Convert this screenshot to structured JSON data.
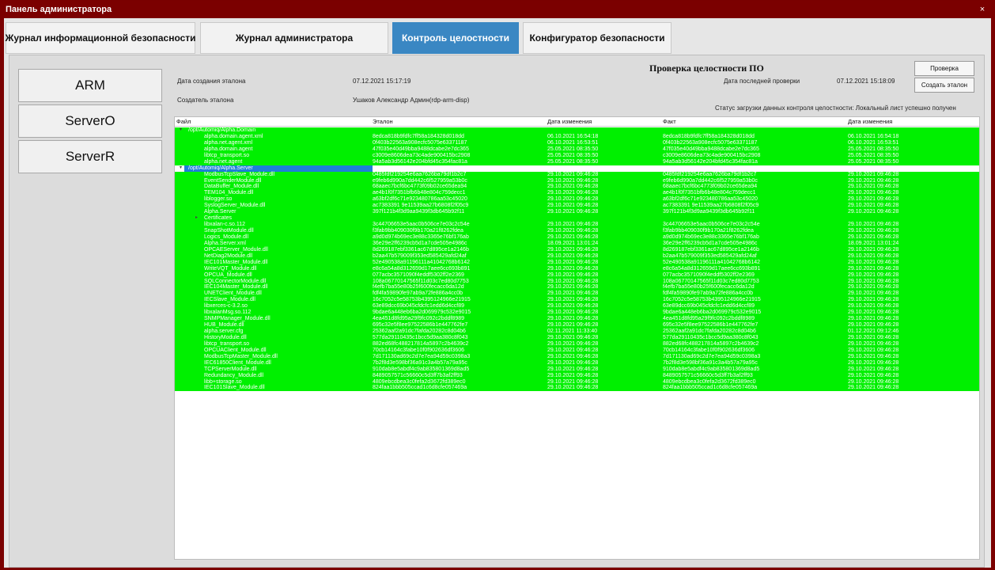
{
  "window": {
    "title": "Панель администратора",
    "close_glyph": "×"
  },
  "tabs": [
    {
      "label": "Журнал информационной безопасности",
      "active": false
    },
    {
      "label": "Журнал администратора",
      "active": false
    },
    {
      "label": "Контроль целостности",
      "active": true
    },
    {
      "label": "Конфигуратор безопасности",
      "active": false
    }
  ],
  "servers": [
    "ARM",
    "ServerO",
    "ServerR"
  ],
  "info": {
    "title": "Проверка целостности ПО",
    "created_label": "Дата создания эталона",
    "created_value": "07.12.2021 15:17:19",
    "creator_label": "Создатель эталона",
    "creator_value": "Ушаков Александр Админ(rdp-arm-disp)",
    "last_check_label": "Дата последней проверки",
    "last_check_value": "07.12.2021 15:18:09",
    "status": "Статус загрузки данных контроля целостности: Локальный лист успешно получен"
  },
  "buttons": {
    "check": "Проверка",
    "create": "Создать эталон"
  },
  "table": {
    "headers": [
      "Файл",
      "Эталон",
      "Дата изменения",
      "Факт",
      "Дата изменения"
    ],
    "rows": [
      {
        "indent": 1,
        "arrow": "▾",
        "file": "/opt/Automiq/Alpha.Domain",
        "ref": "",
        "d1": "",
        "fact": "",
        "d2": "",
        "green": true
      },
      {
        "indent": 2,
        "file": "alpha.domain.agent.xml",
        "ref": "8edca818b9fdfc7ff58a184328d018dd",
        "d1": "06.10.2021 16:54:18",
        "fact": "8edca818b9fdfc7ff58a184328d018dd",
        "d2": "06.10.2021 16:54:18",
        "green": true
      },
      {
        "indent": 2,
        "file": "alpha.net.agent.xml",
        "ref": "0f403b22563a908ecfc5075e63371187",
        "d1": "06.10.2021 16:53:51",
        "fact": "0f403b22563a908ecfc5075e63371187",
        "d2": "06.10.2021 16:53:51",
        "green": true
      },
      {
        "indent": 2,
        "file": "alpha.domain.agent",
        "ref": "47f035e40d49bba9488dcabe2e7dc365",
        "d1": "25.05.2021 08:35:50",
        "fact": "47f035e40d49bba9488dcabe2e7dc365",
        "d2": "25.05.2021 08:35:50",
        "green": true
      },
      {
        "indent": 2,
        "file": "libtcp_transport.so",
        "ref": "c3009e8606dea73c4ade900415bc2908",
        "d1": "25.05.2021 08:35:50",
        "fact": "c3009e8606dea73c4ade900415bc2908",
        "d2": "25.05.2021 08:35:50",
        "green": true
      },
      {
        "indent": 2,
        "file": "alpha.net.agent",
        "ref": "94a5ab3d56142e204bfd45c354fac81a",
        "d1": "25.05.2021 08:35:50",
        "fact": "94a5ab3d56142e204bfd45c354fac81a",
        "d2": "25.05.2021 08:35:50",
        "green": true
      },
      {
        "indent": 1,
        "arrow": "▾",
        "file": "/opt/Automiq/Alpha.Server",
        "ref": "",
        "d1": "",
        "fact": "",
        "d2": "",
        "green": false,
        "selected": true
      },
      {
        "indent": 2,
        "file": "ModbusTcpSlave_Module.dll",
        "ref": "0485fdf219254e6aa7626ba79df1b2c7",
        "d1": "29.10.2021 09:46:28",
        "fact": "0485fdf219254e6aa7626ba79df1b2c7",
        "d2": "29.10.2021 09:46:28",
        "green": true
      },
      {
        "indent": 2,
        "file": "EventSenderModule.dll",
        "ref": "e9feb6d990a7dd442c6f527959a53b0c",
        "d1": "29.10.2021 09:46:28",
        "fact": "e9feb6d990a7dd442c6f527959a53b0c",
        "d2": "29.10.2021 09:46:28",
        "green": true
      },
      {
        "indent": 2,
        "file": "DataBuffer_Module.dll",
        "ref": "68aaec7bcf6bc4773f09b02ce65dea94",
        "d1": "29.10.2021 09:46:28",
        "fact": "68aaec7bcf6bc4773f09b02ce65dea94",
        "d2": "29.10.2021 09:46:28",
        "green": true
      },
      {
        "indent": 2,
        "file": "TEM104_Module.dll",
        "ref": "ae4b1f0f7351bfb6b48e804c759decc1",
        "d1": "29.10.2021 09:46:28",
        "fact": "ae4b1f0f7351bfb6b48e804c759decc1",
        "d2": "29.10.2021 09:46:28",
        "green": true
      },
      {
        "indent": 2,
        "file": "liblogger.so",
        "ref": "a63bf2df6c71e923480786aa53c45020",
        "d1": "29.10.2021 09:46:28",
        "fact": "a63bf2df6c71e923480786aa53c45020",
        "d2": "29.10.2021 09:46:28",
        "green": true
      },
      {
        "indent": 2,
        "file": "SyslogServer_Module.dll",
        "ref": "ac7383391 9e11539aa27b6808f2f05c9",
        "d1": "29.10.2021 09:46:28",
        "fact": "ac7383391 9e11539aa27b6808f2f05c9",
        "d2": "29.10.2021 09:46:28",
        "green": true
      },
      {
        "indent": 2,
        "file": "Alpha.Server",
        "ref": "397f121b4f3d9aa9439f3db645b92f11",
        "d1": "29.10.2021 09:46:28",
        "fact": "397f121b4f3d9aa9439f3db645b92f11",
        "d2": "29.10.2021 09:46:28",
        "green": true
      },
      {
        "indent": 2,
        "arrow": "▸",
        "file": "Certificates",
        "ref": "",
        "d1": "",
        "fact": "",
        "d2": "",
        "green": true
      },
      {
        "indent": 2,
        "file": "libxalan-c.so.112",
        "ref": "3c44706653e5aac0b506ce7e03c2c54e",
        "d1": "29.10.2021 09:46:28",
        "fact": "3c44706653e5aac0b506ce7e03c2c54e",
        "d2": "29.10.2021 09:46:28",
        "green": true
      },
      {
        "indent": 2,
        "file": "SnapShotModule.dll",
        "ref": "f3fab9bb409030f9b170a21f8262fdea",
        "d1": "29.10.2021 09:46:28",
        "fact": "f3fab9bb409030f9b170a21f8262fdea",
        "d2": "29.10.2021 09:46:28",
        "green": true
      },
      {
        "indent": 2,
        "file": "Logics_Module.dll",
        "ref": "a9d0d974b69ec3e88c3365e76bf176ab",
        "d1": "29.10.2021 09:46:28",
        "fact": "a9d0d974b69ec3e88c3365e76bf176ab",
        "d2": "29.10.2021 09:46:28",
        "green": true
      },
      {
        "indent": 2,
        "file": "Alpha.Server.xml",
        "ref": "36e29e2ff6239cb5d1a7cde505e4986c",
        "d1": "18.09.2021 13:01:24",
        "fact": "36e29e2ff6239cb5d1a7cde505e4986c",
        "d2": "18.09.2021 13:01:24",
        "green": true
      },
      {
        "indent": 2,
        "file": "OPCAEServer_Module.dll",
        "ref": "8d269187ebf3361ac67d895ce1a2146b",
        "d1": "29.10.2021 09:46:28",
        "fact": "8d269187ebf3361ac67d895ce1a2146b",
        "d2": "29.10.2021 09:46:28",
        "green": true
      },
      {
        "indent": 2,
        "file": "NetDiag2Module.dll",
        "ref": "b2aa47b579009f353ed585429afd24af",
        "d1": "29.10.2021 09:46:28",
        "fact": "b2aa47b579009f353ed585429afd24af",
        "d2": "29.10.2021 09:46:28",
        "green": true
      },
      {
        "indent": 2,
        "file": "IEC101Master_Module.dll",
        "ref": "52e490538a91196111a41042768b6142",
        "d1": "29.10.2021 09:46:28",
        "fact": "52e490538a91196111a41042768b6142",
        "d2": "29.10.2021 09:46:28",
        "green": true
      },
      {
        "indent": 2,
        "file": "WriteVQT_Module.dll",
        "ref": "e8c6a54a8d312659d17aee6cc693b891",
        "d1": "29.10.2021 09:46:28",
        "fact": "e8c6a54a8d312659d17aee6cc693b891",
        "d2": "29.10.2021 09:46:28",
        "green": true
      },
      {
        "indent": 2,
        "file": "OPCUA_Module.dll",
        "ref": "077acbc3571090f4eddf5302ff2e2369",
        "d1": "29.10.2021 09:46:28",
        "fact": "077acbc3571090f4eddf5302ff2e2369",
        "d2": "29.10.2021 09:46:28",
        "green": true
      },
      {
        "indent": 2,
        "file": "SQLConnectorModule.dll",
        "ref": "108a06770147565f11d03c7ed80d7753",
        "d1": "29.10.2021 09:46:28",
        "fact": "108a06770147565f11d03c7ed80d7753",
        "d2": "29.10.2021 09:46:28",
        "green": true
      },
      {
        "indent": 2,
        "file": "IEC104Master_Module.dll",
        "ref": "f4efb7ba55e80b25f600fecacc6da12d",
        "d1": "29.10.2021 09:46:28",
        "fact": "f4efb7ba55e80b25f600fecacc6da12d",
        "d2": "29.10.2021 09:46:28",
        "green": true
      },
      {
        "indent": 2,
        "file": "UNETClient_Module.dll",
        "ref": "fdf4fa59890fe97ab9a72fe886a4cc0b",
        "d1": "29.10.2021 09:46:28",
        "fact": "fdf4fa59890fe97ab9a72fe886a4cc0b",
        "d2": "29.10.2021 09:46:28",
        "green": true
      },
      {
        "indent": 2,
        "file": "IECSlave_Module.dll",
        "ref": "16c7052c5e58753b4395124966e21915",
        "d1": "29.10.2021 09:46:28",
        "fact": "16c7052c5e58753b4395124966e21915",
        "d2": "29.10.2021 09:46:28",
        "green": true
      },
      {
        "indent": 2,
        "file": "libxerces-c-3.2.so",
        "ref": "63e89dcc69b045cfdcfc1edd6d4ccf89",
        "d1": "29.10.2021 09:46:28",
        "fact": "63e89dcc69b045cfdcfc1edd6d4ccf89",
        "d2": "29.10.2021 09:46:28",
        "green": true
      },
      {
        "indent": 2,
        "file": "libxalanMsg.so.112",
        "ref": "9bdae6a448eb6ba2d069979c532e9015",
        "d1": "29.10.2021 09:46:28",
        "fact": "9bdae6a448eb6ba2d069979c532e9015",
        "d2": "29.10.2021 09:46:28",
        "green": true
      },
      {
        "indent": 2,
        "file": "SNMPManager_Module.dll",
        "ref": "4ea451d8fd95a29f9fc092c2bddf8989",
        "d1": "29.10.2021 09:46:28",
        "fact": "4ea451d8fd95a29f9fc092c2bddf8989",
        "d2": "29.10.2021 09:46:28",
        "green": true
      },
      {
        "indent": 2,
        "file": "HUB_Module.dll",
        "ref": "695c32e5f8ee97522586b1e447762fe7",
        "d1": "29.10.2021 09:46:28",
        "fact": "695c32e5f8ee97522586b1e447762fe7",
        "d2": "29.10.2021 09:46:28",
        "green": true
      },
      {
        "indent": 2,
        "file": "alpha.server.cfg",
        "ref": "25362aaf2a91dc7fafda20282c8d04b6",
        "d1": "02.11.2021 11:33:40",
        "fact": "25362aaf2a91dc7fafda20282c8d04b6",
        "d2": "01.12.2021 09:12:46",
        "green": true
      },
      {
        "indent": 2,
        "file": "HistoryModule.dll",
        "ref": "577da29110435c1bcc5d9aa380c8f043",
        "d1": "29.10.2021 09:46:28",
        "fact": "577da29110435c1bcc5d9aa380c8f043",
        "d2": "29.10.2021 09:46:28",
        "green": true
      },
      {
        "indent": 2,
        "file": "libtcp_transport.so",
        "ref": "882ed68fc488217814a5897c2b4639c2",
        "d1": "29.10.2021 09:46:28",
        "fact": "882ed68fc488217814a5897c2b4639c2",
        "d2": "29.10.2021 09:46:28",
        "green": true
      },
      {
        "indent": 2,
        "file": "OPCUAClient_Module.dll",
        "ref": "70cb14164c3fabe10f0f902636df3606",
        "d1": "29.10.2021 09:46:28",
        "fact": "70cb14164c3fabe10f0f902636df3606",
        "d2": "29.10.2021 09:46:28",
        "green": true
      },
      {
        "indent": 2,
        "file": "ModbusTcpMaster_Module.dll",
        "ref": "7d171130ad69c2d7e7ea94d59c0398a3",
        "d1": "29.10.2021 09:46:28",
        "fact": "7d171130ad69c2d7e7ea94d59c0398a3",
        "d2": "29.10.2021 09:46:28",
        "green": true
      },
      {
        "indent": 2,
        "file": "IEC61850Client_Module.dll",
        "ref": "7b2f8d3e598bf36a91c3a4b57a79a95c",
        "d1": "29.10.2021 09:46:28",
        "fact": "7b2f8d3e598bf36a91c3a4b57a79a95c",
        "d2": "29.10.2021 09:46:28",
        "green": true
      },
      {
        "indent": 2,
        "file": "TCPServerModule.dll",
        "ref": "910dab8e5abdf4c9ab835801369d8ad5",
        "d1": "29.10.2021 09:46:28",
        "fact": "910dab8e5abdf4c9ab835801369d8ad5",
        "d2": "29.10.2021 09:46:28",
        "green": true
      },
      {
        "indent": 2,
        "file": "Redundancy_Module.dll",
        "ref": "8489057571c56660c5d3ff7b3af2ff93",
        "d1": "29.10.2021 09:46:28",
        "fact": "8489057571c56660c5d3ff7b3af2ff93",
        "d2": "29.10.2021 09:46:28",
        "green": true
      },
      {
        "indent": 2,
        "file": "libb+storage.so",
        "ref": "4809ebcdbea3c0fefa2d3672fd389ec0",
        "d1": "29.10.2021 09:46:28",
        "fact": "4809ebcdbea3c0fefa2d3672fd389ec0",
        "d2": "29.10.2021 09:46:28",
        "green": true
      },
      {
        "indent": 2,
        "file": "IEC101Slave_Module.dll",
        "ref": "824faa1bbb505ccad1c6d8cfe057469a",
        "d1": "29.10.2021 09:46:28",
        "fact": "824faa1bbb505ccad1c6d8cfe057469a",
        "d2": "29.10.2021 09:46:28",
        "green": true
      }
    ]
  },
  "colors": {
    "title_bar": "#7b0000",
    "active_tab": "#3a87c3",
    "ok_row": "#00f000",
    "selected_row": "#1e7fd9"
  }
}
